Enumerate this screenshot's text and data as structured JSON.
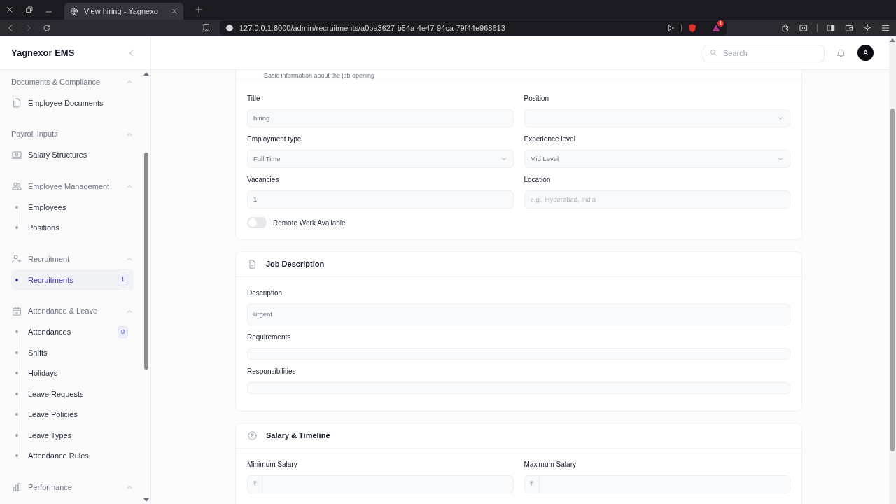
{
  "browser": {
    "tab_title": "View hiring - Yagnexo",
    "url": "127.0.0.1:8000/admin/recruitments/a0ba3627-b54a-4e47-94ca-79f44e968613",
    "notification_count": "1"
  },
  "app": {
    "brand": "Yagnexor EMS",
    "search": {
      "placeholder": "Search"
    },
    "avatar": "A"
  },
  "sidebar": {
    "groups": [
      {
        "label": "Documents & Compliance",
        "expanded": true,
        "items": [
          {
            "kind": "icon",
            "label": "Employee Documents",
            "selected": false
          }
        ]
      },
      {
        "label": "Payroll Inputs",
        "expanded": true,
        "items": [
          {
            "kind": "icon",
            "label": "Salary Structures",
            "selected": false
          }
        ]
      },
      {
        "label": "Employee Management",
        "expanded": true,
        "items": [
          {
            "kind": "bullet",
            "label": "Employees",
            "selected": false
          },
          {
            "kind": "bullet",
            "label": "Positions",
            "selected": false
          }
        ]
      },
      {
        "label": "Recruitment",
        "expanded": true,
        "items": [
          {
            "kind": "bullet",
            "label": "Recruitments",
            "selected": true,
            "badge": "1"
          }
        ]
      },
      {
        "label": "Attendance & Leave",
        "expanded": true,
        "items": [
          {
            "kind": "bullet",
            "label": "Attendances",
            "selected": false,
            "badge": "0"
          },
          {
            "kind": "bullet",
            "label": "Shifts",
            "selected": false
          },
          {
            "kind": "bullet",
            "label": "Holidays",
            "selected": false
          },
          {
            "kind": "bullet",
            "label": "Leave Requests",
            "selected": false
          },
          {
            "kind": "bullet",
            "label": "Leave Policies",
            "selected": false
          },
          {
            "kind": "bullet",
            "label": "Leave Types",
            "selected": false
          },
          {
            "kind": "bullet",
            "label": "Attendance Rules",
            "selected": false
          }
        ]
      },
      {
        "label": "Performance",
        "expanded": true
      }
    ]
  },
  "sections": [
    {
      "subtitle": "Basic information about the job opening",
      "fields": [
        {
          "kind": "text",
          "label": "Title",
          "value": "hiring"
        },
        {
          "kind": "select",
          "label": "Position"
        },
        {
          "kind": "select",
          "label": "Employment type",
          "value": "Full Time"
        },
        {
          "kind": "select",
          "label": "Experience level",
          "value": "Mid Level"
        },
        {
          "kind": "text",
          "label": "Vacancies",
          "value": "1"
        },
        {
          "kind": "text",
          "label": "Location",
          "placeholder": "e.g., Hyderabad, India"
        },
        {
          "kind": "toggle",
          "label": "Remote Work Available",
          "on": false
        }
      ]
    },
    {
      "title": "Job Description",
      "fields": [
        {
          "kind": "textarea",
          "label": "Description",
          "value": "urgent"
        },
        {
          "kind": "textarea",
          "label": "Requirements"
        },
        {
          "kind": "textarea",
          "label": "Responsibilities"
        }
      ]
    },
    {
      "title": "Salary & Timeline",
      "fields": [
        {
          "kind": "currency",
          "label": "Minimum Salary",
          "prefix": "₹"
        },
        {
          "kind": "currency",
          "label": "Maximum Salary",
          "prefix": "₹"
        }
      ]
    }
  ]
}
